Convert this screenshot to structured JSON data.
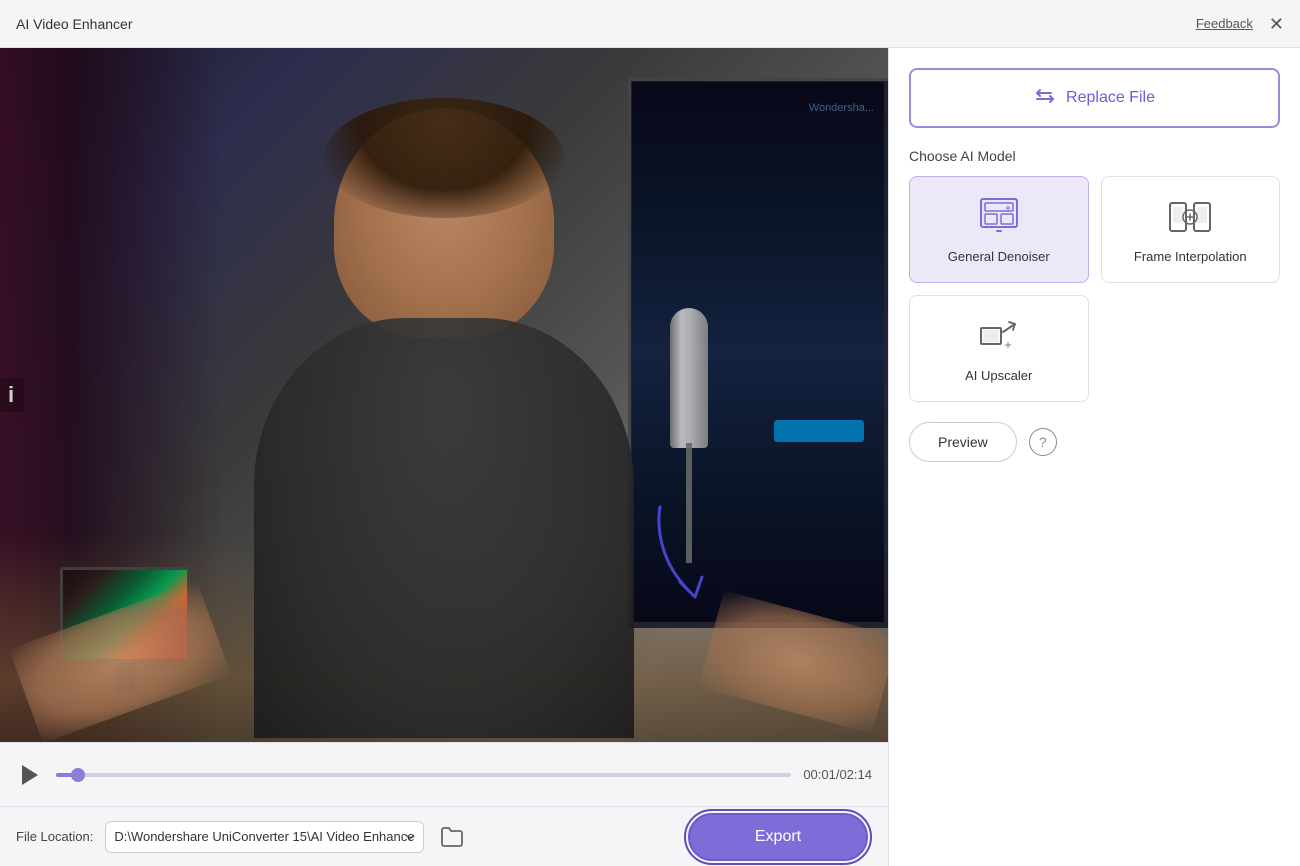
{
  "app": {
    "title": "AI Video Enhancer"
  },
  "titlebar": {
    "feedback_label": "Feedback",
    "close_label": "✕"
  },
  "video": {
    "time_current": "00:01",
    "time_total": "02:14",
    "time_display": "00:01/02:14",
    "progress_percent": 3
  },
  "bottom_bar": {
    "file_location_label": "File Location:",
    "file_path": "D:\\Wondershare UniConverter 15\\AI Video Enhance",
    "folder_icon": "🗁"
  },
  "controls": {
    "replace_file_label": "Replace File",
    "ai_model_section_label": "Choose AI Model",
    "models": [
      {
        "id": "general-denoiser",
        "label": "General Denoiser",
        "selected": true
      },
      {
        "id": "frame-interpolation",
        "label": "Frame\nInterpolation",
        "selected": false
      },
      {
        "id": "ai-upscaler",
        "label": "AI Upscaler",
        "selected": false
      }
    ],
    "preview_label": "Preview",
    "help_label": "?",
    "export_label": "Export"
  }
}
